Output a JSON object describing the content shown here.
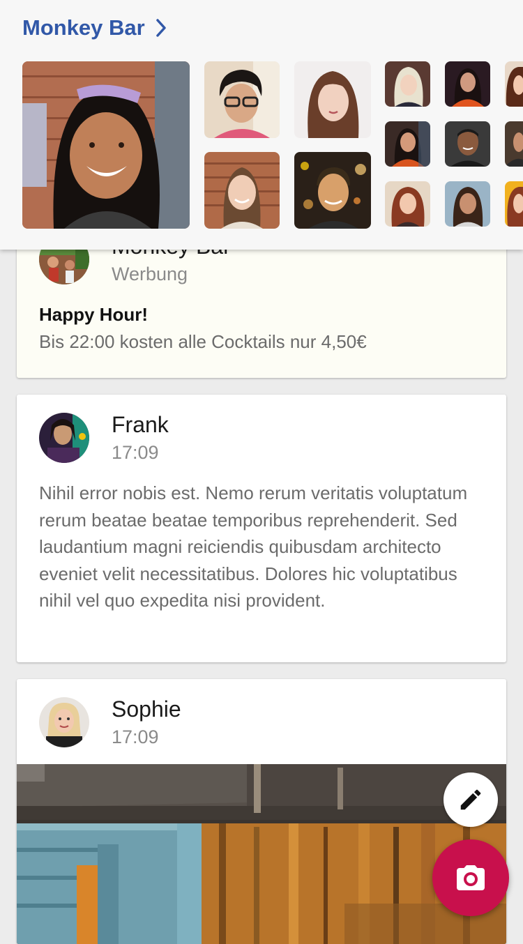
{
  "header": {
    "title": "Monkey Bar",
    "chevron_icon": "chevron-right-icon",
    "accent_color": "#3158a8"
  },
  "posts": [
    {
      "author": "Monkey Bar",
      "meta": "Werbung",
      "title": "Happy Hour!",
      "text": "Bis 22:00 kosten alle Cocktails nur 4,50€"
    },
    {
      "author": "Frank",
      "meta": "17:09",
      "text": "Nihil error nobis est. Nemo rerum veritatis voluptatum rerum beatae beatae temporibus reprehenderit. Sed laudantium magni reiciendis quibusdam architecto eveniet velit necessitatibus. Dolores hic voluptatibus nihil vel quo expedita nisi provident."
    },
    {
      "author": "Sophie",
      "meta": "17:09"
    }
  ],
  "fabs": {
    "edit_icon": "pencil-icon",
    "camera_icon": "camera-icon",
    "camera_color": "#c8104c"
  }
}
